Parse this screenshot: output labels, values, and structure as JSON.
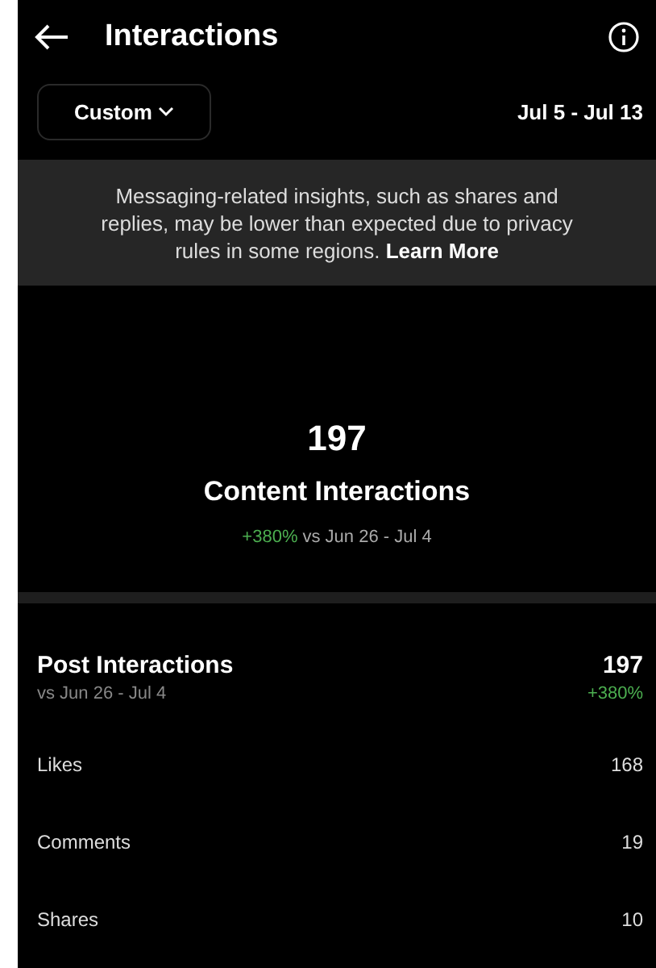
{
  "header": {
    "title": "Interactions"
  },
  "filter": {
    "range": "Custom",
    "dates": "Jul 5 - Jul 13"
  },
  "notice": {
    "text": "Messaging-related insights, such as shares and replies, may be lower than expected due to privacy rules in some regions.",
    "link": "Learn More"
  },
  "summary": {
    "value": "197",
    "label": "Content Interactions",
    "change": "+380%",
    "compare": "vs Jun 26 - Jul 4"
  },
  "post_interactions": {
    "title": "Post Interactions",
    "compare": "vs Jun 26 - Jul 4",
    "value": "197",
    "change": "+380%"
  },
  "metrics": [
    {
      "label": "Likes",
      "value": "168"
    },
    {
      "label": "Comments",
      "value": "19"
    },
    {
      "label": "Shares",
      "value": "10"
    }
  ]
}
